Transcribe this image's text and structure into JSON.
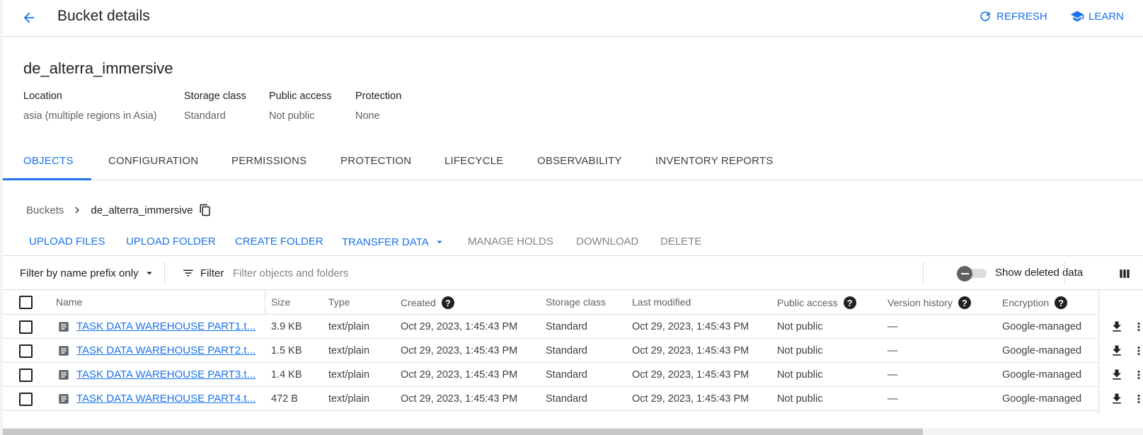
{
  "header": {
    "title": "Bucket details",
    "refresh_label": "REFRESH",
    "learn_label": "LEARN"
  },
  "bucket": {
    "name": "de_alterra_immersive",
    "meta": [
      {
        "label": "Location",
        "value": "asia (multiple regions in Asia)"
      },
      {
        "label": "Storage class",
        "value": "Standard"
      },
      {
        "label": "Public access",
        "value": "Not public"
      },
      {
        "label": "Protection",
        "value": "None"
      }
    ]
  },
  "tabs": [
    "OBJECTS",
    "CONFIGURATION",
    "PERMISSIONS",
    "PROTECTION",
    "LIFECYCLE",
    "OBSERVABILITY",
    "INVENTORY REPORTS"
  ],
  "active_tab": "OBJECTS",
  "breadcrumb": {
    "root": "Buckets",
    "current": "de_alterra_immersive"
  },
  "toolbar": {
    "upload_files": "UPLOAD FILES",
    "upload_folder": "UPLOAD FOLDER",
    "create_folder": "CREATE FOLDER",
    "transfer_data": "TRANSFER DATA",
    "manage_holds": "MANAGE HOLDS",
    "download": "DOWNLOAD",
    "delete": "DELETE"
  },
  "filter": {
    "prefix_label": "Filter by name prefix only",
    "filter_label": "Filter",
    "placeholder": "Filter objects and folders",
    "show_deleted_label": "Show deleted data"
  },
  "table": {
    "headers": {
      "name": "Name",
      "size": "Size",
      "type": "Type",
      "created": "Created",
      "storage_class": "Storage class",
      "last_modified": "Last modified",
      "public_access": "Public access",
      "version_history": "Version history",
      "encryption": "Encryption"
    },
    "rows": [
      {
        "name": "TASK DATA WAREHOUSE PART1.t...",
        "size": "3.9 KB",
        "type": "text/plain",
        "created": "Oct 29, 2023, 1:45:43 PM",
        "storage_class": "Standard",
        "last_modified": "Oct 29, 2023, 1:45:43 PM",
        "public_access": "Not public",
        "version_history": "—",
        "encryption": "Google-managed"
      },
      {
        "name": "TASK DATA WAREHOUSE PART2.t...",
        "size": "1.5 KB",
        "type": "text/plain",
        "created": "Oct 29, 2023, 1:45:43 PM",
        "storage_class": "Standard",
        "last_modified": "Oct 29, 2023, 1:45:43 PM",
        "public_access": "Not public",
        "version_history": "—",
        "encryption": "Google-managed"
      },
      {
        "name": "TASK DATA WAREHOUSE PART3.t...",
        "size": "1.4 KB",
        "type": "text/plain",
        "created": "Oct 29, 2023, 1:45:43 PM",
        "storage_class": "Standard",
        "last_modified": "Oct 29, 2023, 1:45:43 PM",
        "public_access": "Not public",
        "version_history": "—",
        "encryption": "Google-managed"
      },
      {
        "name": "TASK DATA WAREHOUSE PART4.t...",
        "size": "472 B",
        "type": "text/plain",
        "created": "Oct 29, 2023, 1:45:43 PM",
        "storage_class": "Standard",
        "last_modified": "Oct 29, 2023, 1:45:43 PM",
        "public_access": "Not public",
        "version_history": "—",
        "encryption": "Google-managed"
      }
    ]
  },
  "colors": {
    "accent": "#1a73e8",
    "text": "#202124",
    "muted": "#5f6368",
    "divider": "#dadce0"
  }
}
